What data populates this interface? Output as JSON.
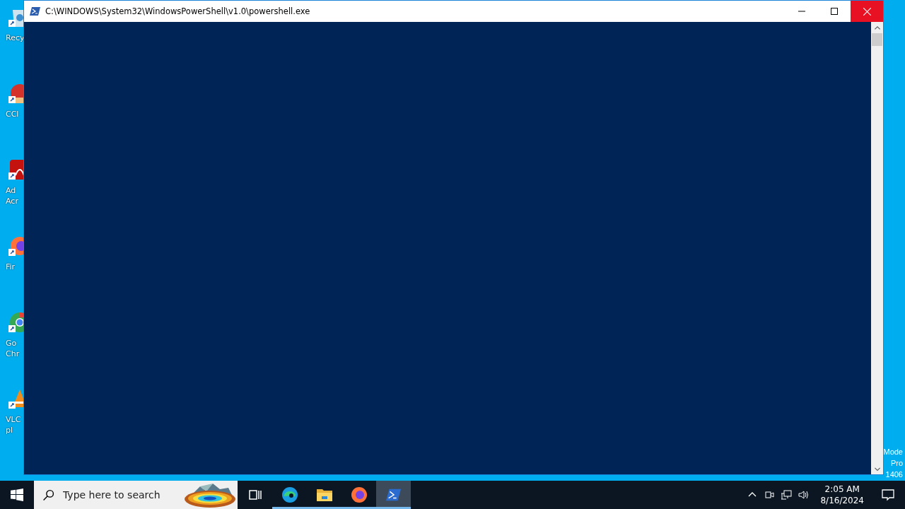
{
  "desktop": {
    "icons": [
      {
        "kind": "recycle",
        "lines": [
          "Recy"
        ]
      },
      {
        "kind": "ccleaner",
        "lines": [
          "CCl"
        ]
      },
      {
        "kind": "acrobat",
        "lines": [
          "Ad",
          "Acr"
        ]
      },
      {
        "kind": "firefox",
        "lines": [
          "Fir"
        ]
      },
      {
        "kind": "chrome",
        "lines": [
          "Go",
          "Chr"
        ]
      },
      {
        "kind": "vlc",
        "lines": [
          "VLC",
          "pl"
        ]
      }
    ],
    "watermark_lines": [
      "Mode",
      "Pro",
      "1406"
    ]
  },
  "window": {
    "title": "C:\\WINDOWS\\System32\\WindowsPowerShell\\v1.0\\powershell.exe"
  },
  "taskbar": {
    "search": {
      "placeholder": "Type here to search"
    },
    "apps": [
      {
        "kind": "taskview",
        "running": false,
        "selected": false
      },
      {
        "kind": "edge",
        "running": true,
        "selected": false
      },
      {
        "kind": "explorer",
        "running": true,
        "selected": false
      },
      {
        "kind": "firefox",
        "running": true,
        "selected": false
      },
      {
        "kind": "powershell",
        "running": true,
        "selected": true
      }
    ],
    "time": "2:05 AM",
    "date": "8/16/2024"
  }
}
